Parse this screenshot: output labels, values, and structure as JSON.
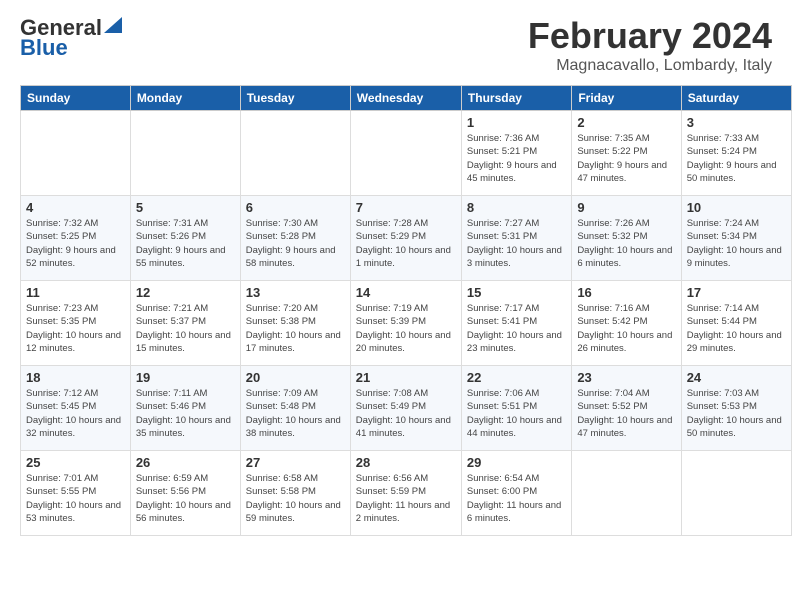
{
  "header": {
    "logo_general": "General",
    "logo_blue": "Blue",
    "month_title": "February 2024",
    "location": "Magnacavallo, Lombardy, Italy"
  },
  "calendar": {
    "days_of_week": [
      "Sunday",
      "Monday",
      "Tuesday",
      "Wednesday",
      "Thursday",
      "Friday",
      "Saturday"
    ],
    "weeks": [
      [
        {
          "day": "",
          "info": ""
        },
        {
          "day": "",
          "info": ""
        },
        {
          "day": "",
          "info": ""
        },
        {
          "day": "",
          "info": ""
        },
        {
          "day": "1",
          "info": "Sunrise: 7:36 AM\nSunset: 5:21 PM\nDaylight: 9 hours and 45 minutes."
        },
        {
          "day": "2",
          "info": "Sunrise: 7:35 AM\nSunset: 5:22 PM\nDaylight: 9 hours and 47 minutes."
        },
        {
          "day": "3",
          "info": "Sunrise: 7:33 AM\nSunset: 5:24 PM\nDaylight: 9 hours and 50 minutes."
        }
      ],
      [
        {
          "day": "4",
          "info": "Sunrise: 7:32 AM\nSunset: 5:25 PM\nDaylight: 9 hours and 52 minutes."
        },
        {
          "day": "5",
          "info": "Sunrise: 7:31 AM\nSunset: 5:26 PM\nDaylight: 9 hours and 55 minutes."
        },
        {
          "day": "6",
          "info": "Sunrise: 7:30 AM\nSunset: 5:28 PM\nDaylight: 9 hours and 58 minutes."
        },
        {
          "day": "7",
          "info": "Sunrise: 7:28 AM\nSunset: 5:29 PM\nDaylight: 10 hours and 1 minute."
        },
        {
          "day": "8",
          "info": "Sunrise: 7:27 AM\nSunset: 5:31 PM\nDaylight: 10 hours and 3 minutes."
        },
        {
          "day": "9",
          "info": "Sunrise: 7:26 AM\nSunset: 5:32 PM\nDaylight: 10 hours and 6 minutes."
        },
        {
          "day": "10",
          "info": "Sunrise: 7:24 AM\nSunset: 5:34 PM\nDaylight: 10 hours and 9 minutes."
        }
      ],
      [
        {
          "day": "11",
          "info": "Sunrise: 7:23 AM\nSunset: 5:35 PM\nDaylight: 10 hours and 12 minutes."
        },
        {
          "day": "12",
          "info": "Sunrise: 7:21 AM\nSunset: 5:37 PM\nDaylight: 10 hours and 15 minutes."
        },
        {
          "day": "13",
          "info": "Sunrise: 7:20 AM\nSunset: 5:38 PM\nDaylight: 10 hours and 17 minutes."
        },
        {
          "day": "14",
          "info": "Sunrise: 7:19 AM\nSunset: 5:39 PM\nDaylight: 10 hours and 20 minutes."
        },
        {
          "day": "15",
          "info": "Sunrise: 7:17 AM\nSunset: 5:41 PM\nDaylight: 10 hours and 23 minutes."
        },
        {
          "day": "16",
          "info": "Sunrise: 7:16 AM\nSunset: 5:42 PM\nDaylight: 10 hours and 26 minutes."
        },
        {
          "day": "17",
          "info": "Sunrise: 7:14 AM\nSunset: 5:44 PM\nDaylight: 10 hours and 29 minutes."
        }
      ],
      [
        {
          "day": "18",
          "info": "Sunrise: 7:12 AM\nSunset: 5:45 PM\nDaylight: 10 hours and 32 minutes."
        },
        {
          "day": "19",
          "info": "Sunrise: 7:11 AM\nSunset: 5:46 PM\nDaylight: 10 hours and 35 minutes."
        },
        {
          "day": "20",
          "info": "Sunrise: 7:09 AM\nSunset: 5:48 PM\nDaylight: 10 hours and 38 minutes."
        },
        {
          "day": "21",
          "info": "Sunrise: 7:08 AM\nSunset: 5:49 PM\nDaylight: 10 hours and 41 minutes."
        },
        {
          "day": "22",
          "info": "Sunrise: 7:06 AM\nSunset: 5:51 PM\nDaylight: 10 hours and 44 minutes."
        },
        {
          "day": "23",
          "info": "Sunrise: 7:04 AM\nSunset: 5:52 PM\nDaylight: 10 hours and 47 minutes."
        },
        {
          "day": "24",
          "info": "Sunrise: 7:03 AM\nSunset: 5:53 PM\nDaylight: 10 hours and 50 minutes."
        }
      ],
      [
        {
          "day": "25",
          "info": "Sunrise: 7:01 AM\nSunset: 5:55 PM\nDaylight: 10 hours and 53 minutes."
        },
        {
          "day": "26",
          "info": "Sunrise: 6:59 AM\nSunset: 5:56 PM\nDaylight: 10 hours and 56 minutes."
        },
        {
          "day": "27",
          "info": "Sunrise: 6:58 AM\nSunset: 5:58 PM\nDaylight: 10 hours and 59 minutes."
        },
        {
          "day": "28",
          "info": "Sunrise: 6:56 AM\nSunset: 5:59 PM\nDaylight: 11 hours and 2 minutes."
        },
        {
          "day": "29",
          "info": "Sunrise: 6:54 AM\nSunset: 6:00 PM\nDaylight: 11 hours and 6 minutes."
        },
        {
          "day": "",
          "info": ""
        },
        {
          "day": "",
          "info": ""
        }
      ]
    ]
  }
}
